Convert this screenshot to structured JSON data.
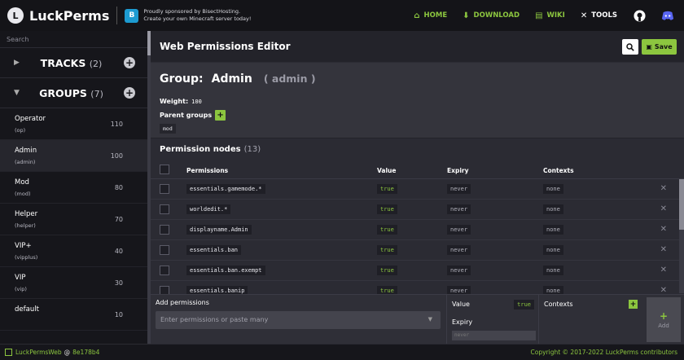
{
  "app": {
    "name": "LuckPerms",
    "logo_letter": "L"
  },
  "sponsor": {
    "line1": "Proudly sponsored by BisectHosting.",
    "line2": "Create your own Minecraft server today!"
  },
  "nav": [
    {
      "label": "HOME",
      "icon": "home-icon"
    },
    {
      "label": "DOWNLOAD",
      "icon": "download-icon"
    },
    {
      "label": "WIKI",
      "icon": "book-icon"
    },
    {
      "label": "TOOLS",
      "icon": "tools-icon"
    }
  ],
  "sidebar": {
    "search_placeholder": "Search",
    "tracks": {
      "label": "TRACKS",
      "count": "(2)"
    },
    "groups": {
      "label": "GROUPS",
      "count": "(7)"
    },
    "items": [
      {
        "name": "Operator",
        "id": "(op)",
        "weight": "110"
      },
      {
        "name": "Admin",
        "id": "(admin)",
        "weight": "100"
      },
      {
        "name": "Mod",
        "id": "(mod)",
        "weight": "80"
      },
      {
        "name": "Helper",
        "id": "(helper)",
        "weight": "70"
      },
      {
        "name": "VIP+",
        "id": "(vipplus)",
        "weight": "40"
      },
      {
        "name": "VIP",
        "id": "(vip)",
        "weight": "30"
      },
      {
        "name": "default",
        "id": "",
        "weight": "10"
      }
    ]
  },
  "editor": {
    "title": "Web Permissions Editor",
    "save_label": "Save",
    "group_prefix": "Group:",
    "group_name": "Admin",
    "group_id": "( admin )",
    "weight_label": "Weight:",
    "weight_value": "100",
    "parents_label": "Parent groups",
    "parent_chip": "mod",
    "nodes_title": "Permission nodes",
    "nodes_count": "(13)",
    "columns": {
      "permissions": "Permissions",
      "value": "Value",
      "expiry": "Expiry",
      "contexts": "Contexts"
    },
    "rows": [
      {
        "perm": "essentials.gamemode.*",
        "value": "true",
        "expiry": "never",
        "contexts": "none"
      },
      {
        "perm": "worldedit.*",
        "value": "true",
        "expiry": "never",
        "contexts": "none"
      },
      {
        "perm": "displayname.Admin",
        "value": "true",
        "expiry": "never",
        "contexts": "none"
      },
      {
        "perm": "essentials.ban",
        "value": "true",
        "expiry": "never",
        "contexts": "none"
      },
      {
        "perm": "essentials.ban.exempt",
        "value": "true",
        "expiry": "never",
        "contexts": "none"
      },
      {
        "perm": "essentials.banip",
        "value": "true",
        "expiry": "never",
        "contexts": "none"
      }
    ]
  },
  "add_panel": {
    "label": "Add permissions",
    "placeholder": "Enter permissions or paste many",
    "value_label": "Value",
    "value": "true",
    "expiry_label": "Expiry",
    "expiry_placeholder": "never",
    "contexts_label": "Contexts",
    "add_label": "Add"
  },
  "footer": {
    "left_name": "LuckPermsWeb",
    "at": "@",
    "commit": "8e178b4",
    "copyright": "Copyright © 2017-2022 LuckPerms contributors"
  },
  "colors": {
    "accent": "#8cc63f",
    "background": "#1f1f26"
  }
}
